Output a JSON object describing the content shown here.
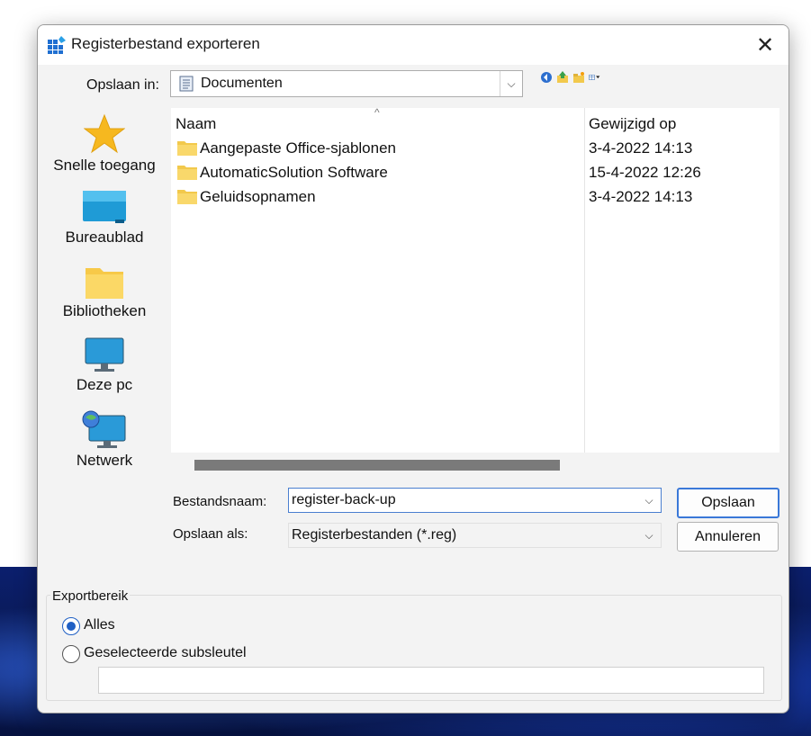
{
  "window": {
    "title": "Registerbestand exporteren",
    "close_glyph": "✕"
  },
  "save_in": {
    "label": "Opslaan in:",
    "value": "Documenten",
    "icon": "documents-icon"
  },
  "toolbar": {
    "icons": [
      "back-icon",
      "up-folder-icon",
      "new-folder-icon",
      "view-menu-icon"
    ]
  },
  "places": [
    {
      "label": "Snelle toegang",
      "icon": "star-icon"
    },
    {
      "label": "Bureaublad",
      "icon": "desktop-icon"
    },
    {
      "label": "Bibliotheken",
      "icon": "libraries-icon"
    },
    {
      "label": "Deze pc",
      "icon": "computer-icon"
    },
    {
      "label": "Netwerk",
      "icon": "network-icon"
    }
  ],
  "columns": {
    "name": "Naam",
    "modified": "Gewijzigd op"
  },
  "files": [
    {
      "name": "Aangepaste Office-sjablonen",
      "modified": "3-4-2022 14:13"
    },
    {
      "name": "AutomaticSolution Software",
      "modified": "15-4-2022 12:26"
    },
    {
      "name": "Geluidsopnamen",
      "modified": "3-4-2022 14:13"
    }
  ],
  "filename": {
    "label": "Bestandsnaam:",
    "value": "register-back-up"
  },
  "filetype": {
    "label": "Opslaan als:",
    "value": "Registerbestanden (*.reg)"
  },
  "buttons": {
    "save": "Opslaan",
    "cancel": "Annuleren"
  },
  "export_range": {
    "title": "Exportbereik",
    "all_label": "Alles",
    "selected_label": "Geselecteerde subsleutel",
    "selected_option": "Alles",
    "subkey_value": ""
  },
  "colors": {
    "accent": "#3a78d8",
    "folder": "#f7c948",
    "dialog_bg": "#f3f3f3"
  }
}
